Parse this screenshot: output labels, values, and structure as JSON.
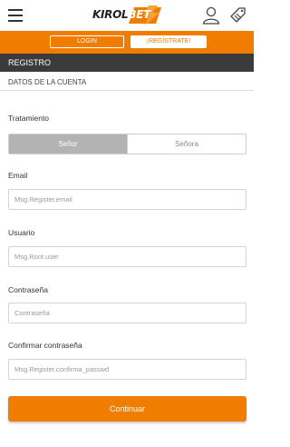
{
  "header": {
    "logo_part1": "KIROL",
    "logo_part2": "BET",
    "menu_icon": "hamburger-icon",
    "user_icon": "user-icon",
    "promo_icon": "tag-icon"
  },
  "auth_bar": {
    "login_label": "LOGIN",
    "register_label": "¡REGÍSTRATE!"
  },
  "section": {
    "title": "REGISTRO",
    "subtitle": "DATOS DE LA CUENTA"
  },
  "form": {
    "treatment_label": "Tratamiento",
    "treatment_options": [
      "Señor",
      "Señora"
    ],
    "treatment_selected": "Señor",
    "email_label": "Email",
    "email_placeholder": "Msg.Register.email",
    "user_label": "Usuario",
    "user_placeholder": "Msg.Root.user",
    "password_label": "Contraseña",
    "password_placeholder": "Contraseña",
    "confirm_label": "Confirmar contraseña",
    "confirm_placeholder": "Msg.Register.confirma_passwd",
    "submit_label": "Continuar"
  },
  "colors": {
    "brand_orange": "#f07c00",
    "section_dark": "#3b3b3b",
    "segment_active": "#b3b3b3"
  }
}
